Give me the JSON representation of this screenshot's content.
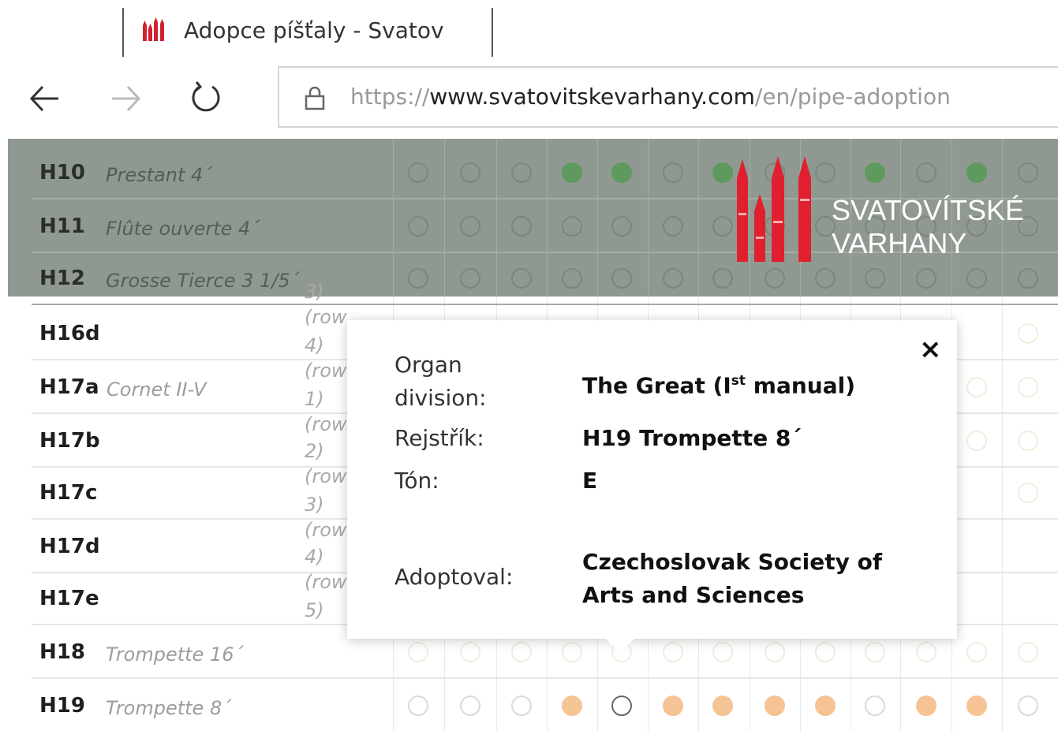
{
  "browser": {
    "tab_title": "Adopce píšťaly - Svatov",
    "url_scheme": "https://",
    "url_host": "www.svatovitskevarhany.com",
    "url_path": "/en/pipe-adoption"
  },
  "logo": {
    "line1": "SVATOVÍTSKÉ",
    "line2": "VARHANY",
    "brand_color": "#e0202e"
  },
  "colors": {
    "adopted_green": "#5e9a5e",
    "adopted_orange": "#f6c395",
    "gray_band": "#8f9991"
  },
  "registers": [
    {
      "code": "H10",
      "name": "Prestant 4´",
      "cells": [
        "e",
        "e",
        "e",
        "g",
        "g",
        "e",
        "g",
        "e",
        "e",
        "g",
        "e",
        "g",
        "e",
        "e"
      ]
    },
    {
      "code": "H11",
      "name": "Flûte ouverte 4´",
      "cells": [
        "e",
        "e",
        "e",
        "e",
        "e",
        "e",
        "e",
        "e",
        "e",
        "e",
        "e",
        "e",
        "e",
        "e"
      ]
    },
    {
      "code": "H12",
      "name": "Grosse Tierce 3 1/5´",
      "cells": [
        "e",
        "e",
        "e",
        "e",
        "e",
        "e",
        "e",
        "e",
        "e",
        "e",
        "e",
        "e",
        "e",
        "e"
      ]
    },
    {
      "code": "H16d",
      "name": "",
      "sub": [
        "3)",
        "(row"
      ]
    },
    {
      "code": "H17a",
      "name": "Cornet II-V",
      "sub": [
        "4)",
        "(row"
      ]
    },
    {
      "code": "H17b",
      "name": "",
      "sub": [
        "1)",
        "(row"
      ]
    },
    {
      "code": "H17c",
      "name": "",
      "sub": [
        "2)",
        "(row"
      ]
    },
    {
      "code": "H17d",
      "name": "",
      "sub": [
        "3)",
        "(row"
      ]
    },
    {
      "code": "H17e",
      "name": "",
      "sub": [
        "4)",
        "(row"
      ]
    },
    {
      "code": "H18",
      "name": "Trompette 16´",
      "sub": [
        "5)"
      ]
    },
    {
      "code": "H19",
      "name": "Trompette 8´",
      "cells": [
        "e",
        "e",
        "e",
        "o",
        "d",
        "o",
        "o",
        "o",
        "o",
        "e",
        "o",
        "o",
        "e"
      ]
    }
  ],
  "popup": {
    "division_label": "Organ division:",
    "division_value": "The Great (I",
    "division_sup": "st",
    "division_value_end": " manual)",
    "register_label": "Rejstřík:",
    "register_value": "H19 Trompette 8´",
    "tone_label": "Tón:",
    "tone_value": "E",
    "adopter_label": "Adoptoval:",
    "adopter_value_line1": "Czechoslovak Society of",
    "adopter_value_line2": "Arts and Sciences",
    "close_glyph": "×"
  }
}
